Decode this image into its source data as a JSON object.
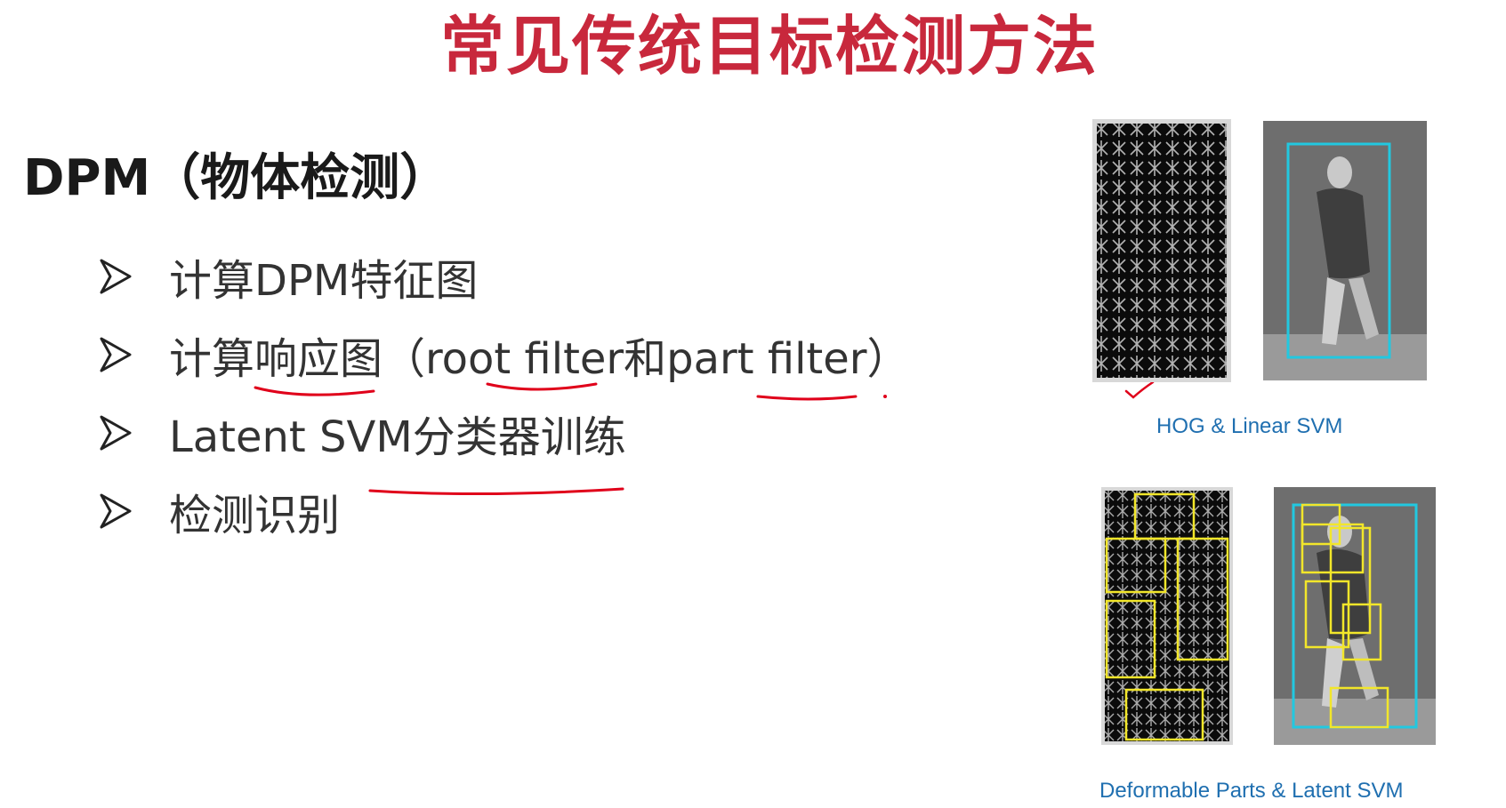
{
  "slide": {
    "title": "常见传统目标检测方法",
    "heading": "DPM（物体检测）",
    "bullets": [
      {
        "text": "计算DPM特征图"
      },
      {
        "text": "计算响应图（root filter和part filter）"
      },
      {
        "text": "Latent SVM分类器训练"
      },
      {
        "text": "检测识别"
      }
    ],
    "title_color": "#c8283c",
    "arrow_icon": "arrowhead-bullet-icon"
  },
  "figures": {
    "top_caption": "HOG & Linear SVM",
    "bottom_caption": "Deformable Parts & Latent SVM",
    "root_box_color": "#22c8e0",
    "part_box_color": "#f2e62a",
    "caption_color": "#1f6fb0"
  },
  "annotations": {
    "ink_color": "#e0001a"
  }
}
